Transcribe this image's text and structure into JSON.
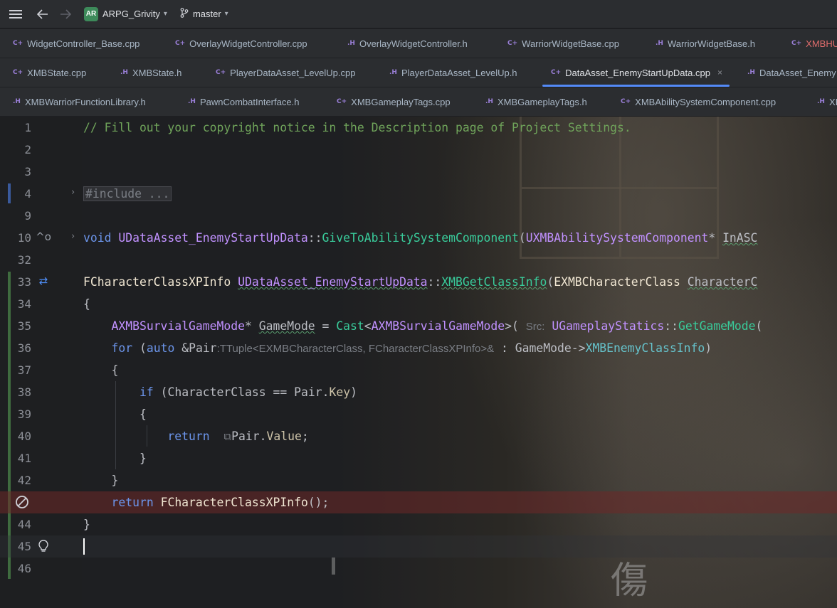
{
  "titlebar": {
    "project_badge": "AR",
    "project_name": "ARPG_Grivity",
    "branch": "master"
  },
  "tabs": {
    "row1": [
      {
        "type": "C++",
        "label": "WidgetController_Base.cpp"
      },
      {
        "type": "C++",
        "label": "OverlayWidgetController.cpp"
      },
      {
        "type": "H",
        "label": "OverlayWidgetController.h"
      },
      {
        "type": "C++",
        "label": "WarriorWidgetBase.cpp"
      },
      {
        "type": "H",
        "label": "WarriorWidgetBase.h"
      },
      {
        "type": "C++",
        "label": "XMBHU"
      }
    ],
    "row2": [
      {
        "type": "C++",
        "label": "XMBState.cpp"
      },
      {
        "type": "H",
        "label": "XMBState.h"
      },
      {
        "type": "C++",
        "label": "PlayerDataAsset_LevelUp.cpp"
      },
      {
        "type": "H",
        "label": "PlayerDataAsset_LevelUp.h"
      },
      {
        "type": "C++",
        "label": "DataAsset_EnemyStartUpData.cpp"
      },
      {
        "type": "H",
        "label": "DataAsset_Enemy"
      }
    ],
    "row3": [
      {
        "type": "H",
        "label": "XMBWarriorFunctionLibrary.h"
      },
      {
        "type": "H",
        "label": "PawnCombatInterface.h"
      },
      {
        "type": "C++",
        "label": "XMBGameplayTags.cpp"
      },
      {
        "type": "H",
        "label": "XMBGameplayTags.h"
      },
      {
        "type": "C++",
        "label": "XMBAbilitySystemComponent.cpp"
      },
      {
        "type": "H",
        "label": "XI"
      }
    ],
    "close_glyph": "×"
  },
  "editor": {
    "line_numbers": [
      "1",
      "2",
      "3",
      "4",
      "9",
      "10",
      "32",
      "33",
      "34",
      "35",
      "36",
      "37",
      "38",
      "39",
      "40",
      "41",
      "42",
      "43",
      "44",
      "45",
      "46"
    ],
    "comment": "// Fill out your copyright notice in the Description page of Project Settings.",
    "include_fold": "#include ...",
    "l10": {
      "kw": "void",
      "cls": "UDataAsset_EnemyStartUpData",
      "sep": "::",
      "fn": "GiveToAbilitySystemComponent",
      "paren": "(",
      "ptype": "UXMBAbilitySystemComponent",
      "star": "* ",
      "param": "InASC"
    },
    "l33": {
      "ret": "FCharacterClassXPInfo",
      "cls": "UDataAsset_EnemyStartUpData",
      "sep": "::",
      "fn": "XMBGetClassInfo",
      "paren": "(",
      "ptype": "EXMBCharacterClass",
      "param": "CharacterC"
    },
    "l34": "{",
    "l35": {
      "type": "AXMBSurvialGameMode",
      "star": "* ",
      "var": "GameMode",
      "eq": " = ",
      "cast": "Cast",
      "lt": "<",
      "ctype": "AXMBSurvialGameMode",
      "gt": ">(",
      "hint": "Src:",
      "scls": "UGameplayStatics",
      "sep": "::",
      "sfn": "GetGameMode",
      "tail": "("
    },
    "l36": {
      "kw": "for",
      "open": " (",
      "auto": "auto",
      "amp": " &",
      "var": "Pair",
      "hint": ":TTuple<EXMBCharacterClass, FCharacterClassXPInfo>&",
      "colon": " : ",
      "obj": "GameMode",
      "arrow": "->",
      "member": "XMBEnemyClassInfo",
      "close": ")"
    },
    "l37": "{",
    "l38": {
      "kw": "if",
      "open": " (",
      "var": "CharacterClass",
      "op": " == ",
      "obj": "Pair",
      "dot": ".",
      "member": "Key",
      "close": ")"
    },
    "l39": "{",
    "l40": {
      "kw": "return",
      "obj": "Pair",
      "dot": ".",
      "member": "Value",
      "semi": ";"
    },
    "l41": "}",
    "l42": "}",
    "l43": {
      "kw": "return",
      "type": "FCharacterClassXPInfo",
      "tail": "();"
    },
    "l44": "}",
    "bg_glyph": "傷"
  }
}
